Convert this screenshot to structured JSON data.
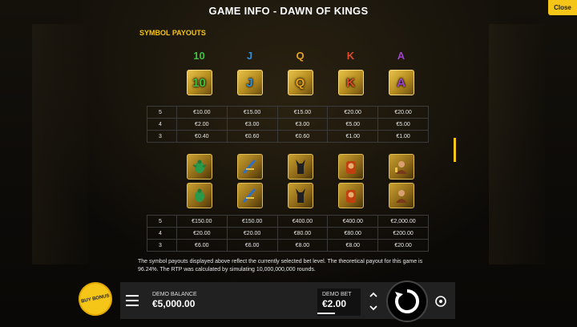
{
  "header": {
    "title": "GAME INFO - DAWN OF KINGS",
    "close_label": "Close"
  },
  "symbol_payouts": {
    "section_title": "SYMBOL PAYOUTS",
    "letter_symbols": [
      {
        "letter": "10",
        "color": "#3fbf3f"
      },
      {
        "letter": "J",
        "color": "#2a8de0"
      },
      {
        "letter": "Q",
        "color": "#e8a020"
      },
      {
        "letter": "K",
        "color": "#e04a2a"
      },
      {
        "letter": "A",
        "color": "#a040d0"
      }
    ],
    "letter_table": [
      {
        "count": "5",
        "values": [
          "€10.00",
          "€15.00",
          "€15.00",
          "€20.00",
          "€20.00"
        ]
      },
      {
        "count": "4",
        "values": [
          "€2.00",
          "€3.00",
          "€3.00",
          "€5.00",
          "€5.00"
        ]
      },
      {
        "count": "3",
        "values": [
          "€0.40",
          "€0.60",
          "€0.60",
          "€1.00",
          "€1.00"
        ]
      }
    ],
    "picture_symbols": [
      {
        "icon": "scarab-icon",
        "color": "#2a9a4a"
      },
      {
        "icon": "eye-of-horus-icon",
        "color": "#3070c0"
      },
      {
        "icon": "anubis-icon",
        "color": "#202020"
      },
      {
        "icon": "pharaoh-icon",
        "color": "#c04010"
      },
      {
        "icon": "queen-icon",
        "color": "#7a3a1a"
      }
    ],
    "picture_table": [
      {
        "count": "5",
        "values": [
          "€150.00",
          "€150.00",
          "€400.00",
          "€400.00",
          "€2,000.00"
        ]
      },
      {
        "count": "4",
        "values": [
          "€20.00",
          "€20.00",
          "€80.00",
          "€80.00",
          "€200.00"
        ]
      },
      {
        "count": "3",
        "values": [
          "€6.00",
          "€6.00",
          "€8.00",
          "€8.00",
          "€20.00"
        ]
      }
    ],
    "rtp_note": "The symbol payouts displayed above reflect the currently selected bet level. The theoretical payout for this game is 96.24%. The RTP was calculated by simulating 10,000,000,000 rounds."
  },
  "bottom_bar": {
    "buy_bonus_label": "BUY BONUS",
    "balance_label": "DEMO BALANCE",
    "balance_value": "€5,000.00",
    "bet_label": "DEMO BET",
    "bet_value": "€2.00"
  },
  "colors": {
    "accent": "#f5c518",
    "background": "#0a0806",
    "bar": "#232323"
  }
}
